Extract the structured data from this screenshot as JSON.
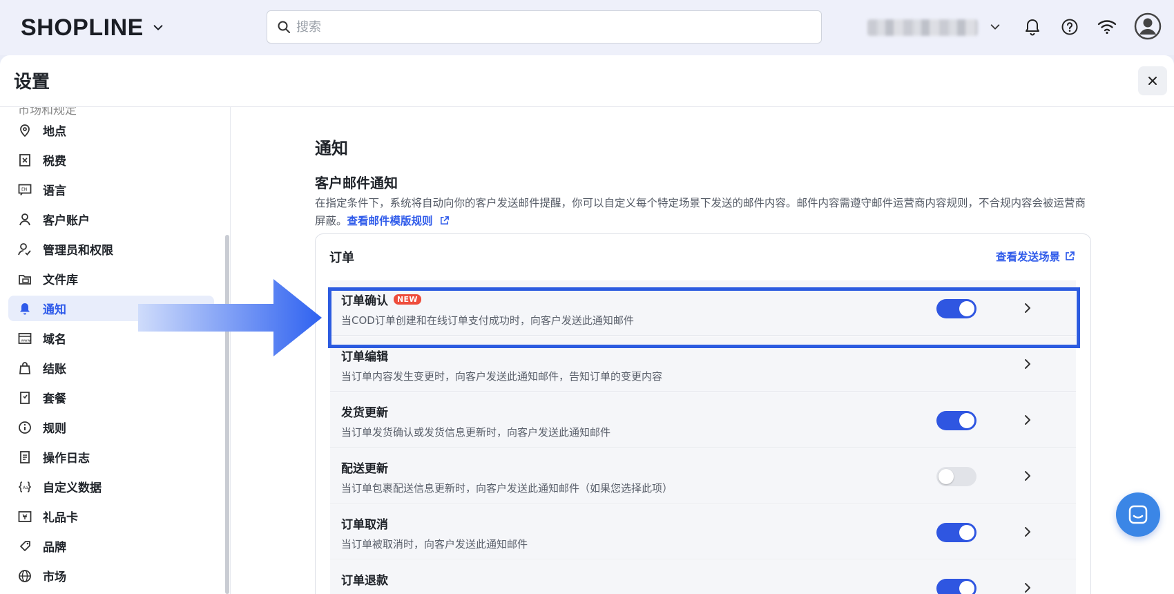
{
  "brand": {
    "logo_text": "SHOPLINE"
  },
  "search": {
    "placeholder": "搜索"
  },
  "panel": {
    "title": "设置"
  },
  "sidebar": {
    "partial_item": "市场和规定",
    "items": [
      {
        "label": "地点",
        "icon": "location-pin-icon"
      },
      {
        "label": "税费",
        "icon": "tax-receipt-icon"
      },
      {
        "label": "语言",
        "icon": "language-icon"
      },
      {
        "label": "客户账户",
        "icon": "user-icon"
      },
      {
        "label": "管理员和权限",
        "icon": "user-permission-icon"
      },
      {
        "label": "文件库",
        "icon": "folder-icon"
      },
      {
        "label": "通知",
        "icon": "bell-icon",
        "active": true
      },
      {
        "label": "域名",
        "icon": "domain-icon"
      },
      {
        "label": "结账",
        "icon": "shopping-bag-icon"
      },
      {
        "label": "套餐",
        "icon": "plan-icon"
      },
      {
        "label": "规则",
        "icon": "info-icon"
      },
      {
        "label": "操作日志",
        "icon": "log-icon"
      },
      {
        "label": "自定义数据",
        "icon": "code-braces-icon"
      },
      {
        "label": "礼品卡",
        "icon": "gift-card-icon"
      },
      {
        "label": "品牌",
        "icon": "brand-tag-icon"
      },
      {
        "label": "市场",
        "icon": "globe-icon"
      }
    ]
  },
  "content": {
    "section_title": "通知",
    "subsection_title": "客户邮件通知",
    "description": "在指定条件下，系统将自动向你的客户发送邮件提醒，你可以自定义每个特定场景下发送的邮件内容。邮件内容需遵守邮件运营商内容规则，不合规内容会被运营商屏蔽。",
    "description_link": "查看邮件模版规则",
    "card": {
      "title": "订单",
      "link": "查看发送场景",
      "rows": [
        {
          "title": "订单确认",
          "badge": "NEW",
          "desc": "当COD订单创建和在线订单支付成功时，向客户发送此通知邮件",
          "toggle": "on"
        },
        {
          "title": "订单编辑",
          "desc": "当订单内容发生变更时，向客户发送此通知邮件，告知订单的变更内容",
          "toggle": "none"
        },
        {
          "title": "发货更新",
          "desc": "当订单发货确认或发货信息更新时，向客户发送此通知邮件",
          "toggle": "on"
        },
        {
          "title": "配送更新",
          "desc": "当订单包裹配送信息更新时，向客户发送此通知邮件（如果您选择此项）",
          "toggle": "off"
        },
        {
          "title": "订单取消",
          "desc": "当订单被取消时，向客户发送此通知邮件",
          "toggle": "on"
        },
        {
          "title": "订单退款",
          "desc": "",
          "toggle": "on"
        }
      ]
    }
  },
  "colors": {
    "accent": "#2f56e1",
    "badge": "#ee4d3c",
    "highlight": "#2c5be0",
    "chat": "#3b86e6"
  }
}
